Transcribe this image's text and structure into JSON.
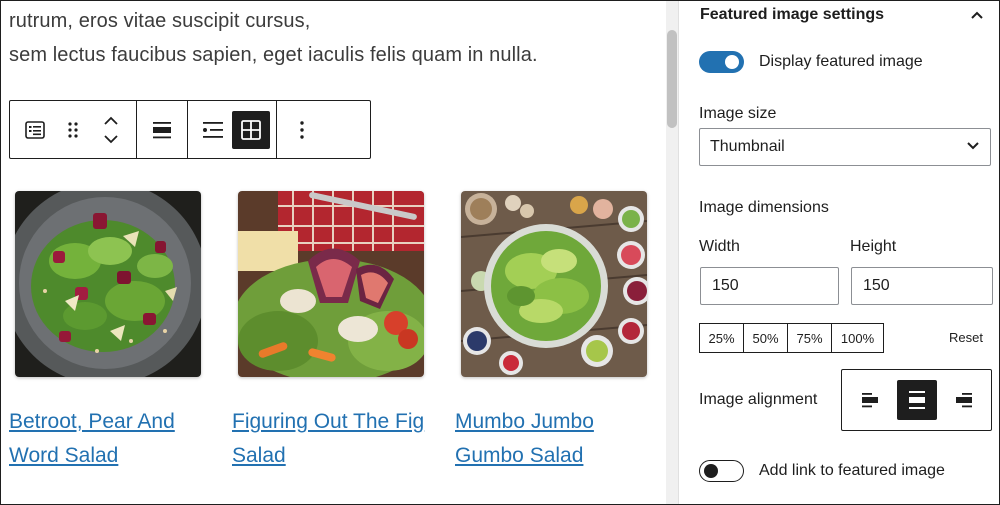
{
  "content": {
    "paragraph_lines": [
      "rutrum, eros vitae suscipit cursus,",
      "sem lectus faucibus sapien, eget iaculis felis quam in nulla."
    ],
    "toolbar": {
      "icons": [
        "latest-posts-block-icon",
        "drag-handle-icon",
        "move-up-down-icon",
        "align-icon",
        "list-view-icon",
        "grid-view-icon",
        "more-options-icon"
      ]
    },
    "posts": [
      {
        "title_line1": "Betroot, Pear And",
        "title_line2": "Word Salad"
      },
      {
        "title_line1": "Figuring Out The Fig",
        "title_line2": "Salad"
      },
      {
        "title_line1": "Mumbo Jumbo",
        "title_line2": "Gumbo Salad"
      }
    ]
  },
  "sidebar": {
    "panel_title": "Featured image settings",
    "display_featured_image": {
      "label": "Display featured image",
      "on": true
    },
    "image_size": {
      "label": "Image size",
      "value": "Thumbnail"
    },
    "image_dimensions": {
      "label": "Image dimensions",
      "width_label": "Width",
      "width_value": "150",
      "height_label": "Height",
      "height_value": "150",
      "presets": [
        "25%",
        "50%",
        "75%",
        "100%"
      ],
      "reset_label": "Reset"
    },
    "image_alignment": {
      "label": "Image alignment",
      "selected": "center"
    },
    "add_link": {
      "label": "Add link to featured image",
      "on": false
    }
  },
  "colors": {
    "accent": "#2271b1",
    "dark": "#1e1e1e",
    "link": "#2271b1"
  }
}
